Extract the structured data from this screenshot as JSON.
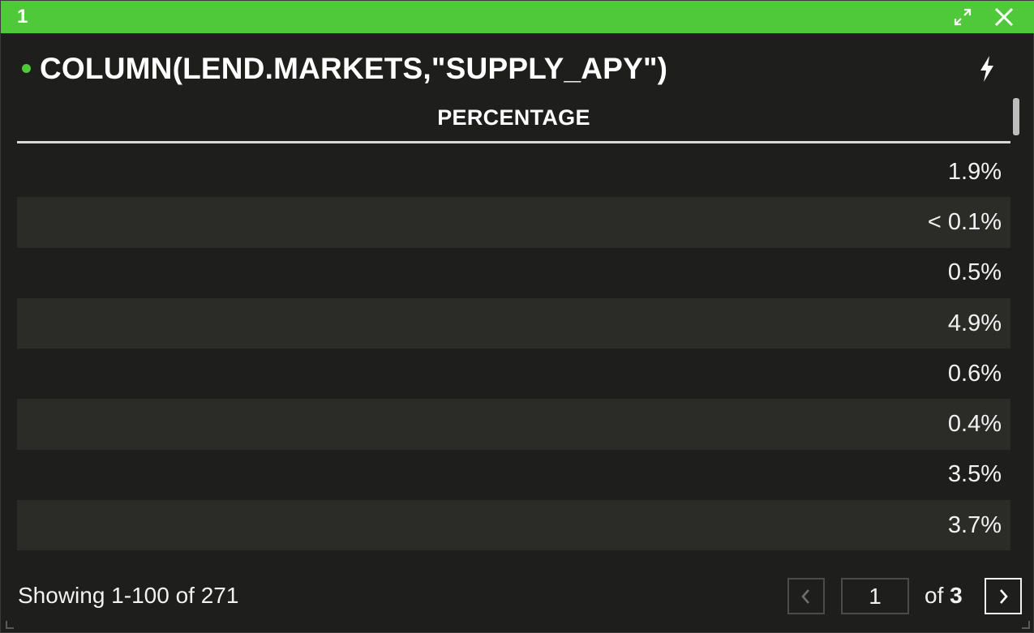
{
  "window": {
    "title": "1",
    "accent_color": "#4fc93a"
  },
  "header": {
    "formula": "COLUMN(LEND.MARKETS,\"SUPPLY_APY\")",
    "status_icon": "status-dot-icon",
    "action_icon": "lightning-bolt-icon"
  },
  "table": {
    "column_header": "PERCENTAGE",
    "rows": [
      "1.9%",
      "< 0.1%",
      "0.5%",
      "4.9%",
      "0.6%",
      "0.4%",
      "3.5%",
      "3.7%"
    ]
  },
  "footer": {
    "showing_text": "Showing 1-100 of 271",
    "page_value": "1",
    "of_text": "of",
    "total_pages": "3"
  }
}
